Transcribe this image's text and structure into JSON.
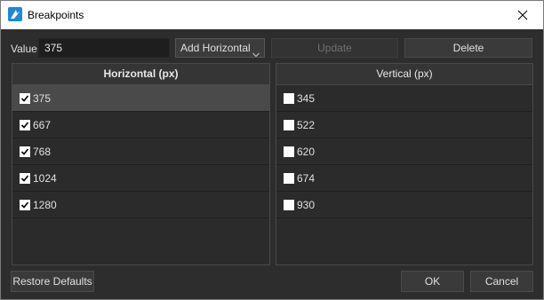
{
  "window": {
    "title": "Breakpoints"
  },
  "toolbar": {
    "value_label": "Value",
    "value_input": "375",
    "orientation_select": "Add Horizontal",
    "update_label": "Update",
    "delete_label": "Delete"
  },
  "horizontal": {
    "header": "Horizontal (px)",
    "rows": [
      {
        "label": "375",
        "checked": true,
        "selected": true
      },
      {
        "label": "667",
        "checked": true
      },
      {
        "label": "768",
        "checked": true
      },
      {
        "label": "1024",
        "checked": true
      },
      {
        "label": "1280",
        "checked": true
      }
    ]
  },
  "vertical": {
    "header": "Vertical (px)",
    "rows": [
      {
        "label": "345",
        "checked": false
      },
      {
        "label": "522",
        "checked": false
      },
      {
        "label": "620",
        "checked": false
      },
      {
        "label": "674",
        "checked": false
      },
      {
        "label": "930",
        "checked": false
      }
    ]
  },
  "footer": {
    "restore_label": "Restore Defaults",
    "ok_label": "OK",
    "cancel_label": "Cancel"
  },
  "colors": {
    "background": "#2d2d2d",
    "selected_row": "#4a4a4a",
    "app_icon": "#1e88d6"
  }
}
